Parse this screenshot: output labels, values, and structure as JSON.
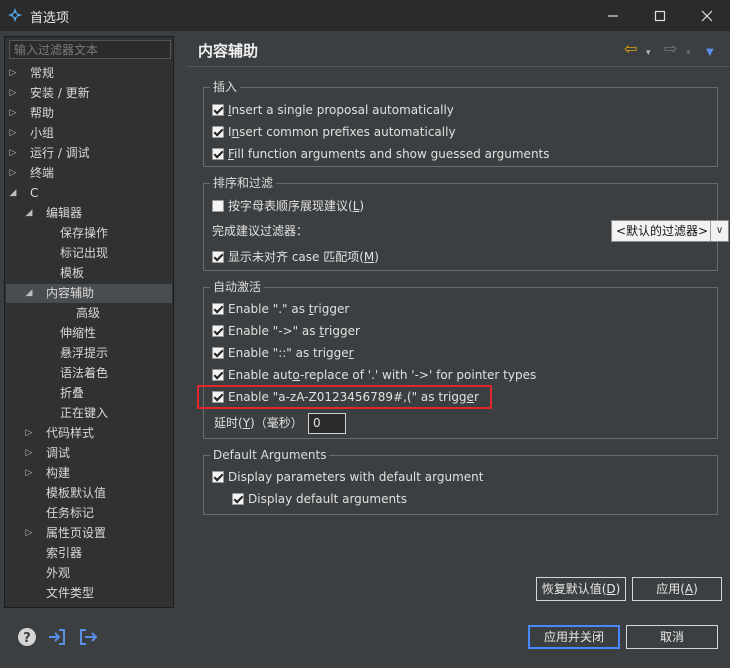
{
  "window": {
    "title": "首选项",
    "min_glyph": "—",
    "max_glyph": "☐",
    "close_glyph": "✕"
  },
  "filter": {
    "placeholder": "输入过滤器文本"
  },
  "tree": [
    {
      "label": "常规",
      "arrow": "▷"
    },
    {
      "label": "安装 / 更新",
      "arrow": "▷"
    },
    {
      "label": "帮助",
      "arrow": "▷"
    },
    {
      "label": "小组",
      "arrow": "▷"
    },
    {
      "label": "运行 / 调试",
      "arrow": "▷"
    },
    {
      "label": "终端",
      "arrow": "▷"
    },
    {
      "label": "C",
      "arrow": "◢"
    },
    {
      "label": "编辑器",
      "arrow": "◢"
    },
    {
      "label": "保存操作",
      "arrow": ""
    },
    {
      "label": "标记出现",
      "arrow": ""
    },
    {
      "label": "模板",
      "arrow": ""
    },
    {
      "label": "内容辅助",
      "arrow": "◢"
    },
    {
      "label": "高级",
      "arrow": ""
    },
    {
      "label": "伸缩性",
      "arrow": ""
    },
    {
      "label": "悬浮提示",
      "arrow": ""
    },
    {
      "label": "语法着色",
      "arrow": ""
    },
    {
      "label": "折叠",
      "arrow": ""
    },
    {
      "label": "正在键入",
      "arrow": ""
    },
    {
      "label": "代码样式",
      "arrow": "▷"
    },
    {
      "label": "调试",
      "arrow": "▷"
    },
    {
      "label": "构建",
      "arrow": "▷"
    },
    {
      "label": "模板默认值",
      "arrow": ""
    },
    {
      "label": "任务标记",
      "arrow": ""
    },
    {
      "label": "属性页设置",
      "arrow": "▷"
    },
    {
      "label": "索引器",
      "arrow": ""
    },
    {
      "label": "外观",
      "arrow": ""
    },
    {
      "label": "文件类型",
      "arrow": ""
    }
  ],
  "page": {
    "title": "内容辅助",
    "nav": {
      "back": "⇦",
      "forward": "⇨",
      "dropdown": "▾",
      "menu": "▼"
    }
  },
  "insert_group": {
    "title": "插入",
    "items": [
      {
        "u": "I",
        "rest": "nsert a single proposal automatically",
        "checked": true
      },
      {
        "pre": "I",
        "u": "n",
        "rest": "sert common prefixes automatically",
        "checked": true
      },
      {
        "u": "F",
        "rest": "ill function arguments and show guessed arguments",
        "checked": true
      }
    ]
  },
  "sort_group": {
    "title": "排序和过滤",
    "alpha_label": "按字母表顺序展现建议(",
    "alpha_key": "L",
    "alpha_end": ")",
    "alpha_checked": false,
    "filter_label": "完成建议过滤器：",
    "filter_value": "<默认的过滤器>",
    "filter_arrow": "∨",
    "case_label": "显示未对齐 case 匹配项(",
    "case_key": "M",
    "case_end": ")",
    "case_checked": true
  },
  "auto_group": {
    "title": "自动激活",
    "items": [
      {
        "pre": "Enable \".\" as ",
        "u": "t",
        "rest": "rigger",
        "checked": true
      },
      {
        "pre": "Enable \"->\" as ",
        "u": "t",
        "rest": "rigger",
        "checked": true
      },
      {
        "pre": "Enable \"::\" as trigge",
        "u": "r",
        "rest": "",
        "checked": true
      },
      {
        "pre": "Enable aut",
        "u": "o",
        "rest": "-replace of '.' with '->' for pointer types",
        "checked": true
      },
      {
        "pre": "Enable \"a-zA-Z0123456789#,(\" as trigg",
        "u": "e",
        "rest": "r",
        "checked": true
      }
    ],
    "delay_label_pre": "延时(",
    "delay_key": "Y",
    "delay_label_post": ")（毫秒）",
    "delay_value": "0"
  },
  "default_args_group": {
    "title": "Default Arguments",
    "display_params": "Display parameters with default argument",
    "display_params_checked": true,
    "display_defaults": "Display default arguments",
    "display_defaults_checked": true
  },
  "buttons": {
    "restore_pre": "恢复默认值(",
    "restore_key": "D",
    "restore_end": ")",
    "apply_pre": "应用(",
    "apply_key": "A",
    "apply_end": ")",
    "apply_close": "应用并关闭",
    "cancel": "取消"
  },
  "colors": {
    "accent": "#4a88ff",
    "highlight": "#e0282c",
    "back_arrow": "#e8a60c"
  }
}
